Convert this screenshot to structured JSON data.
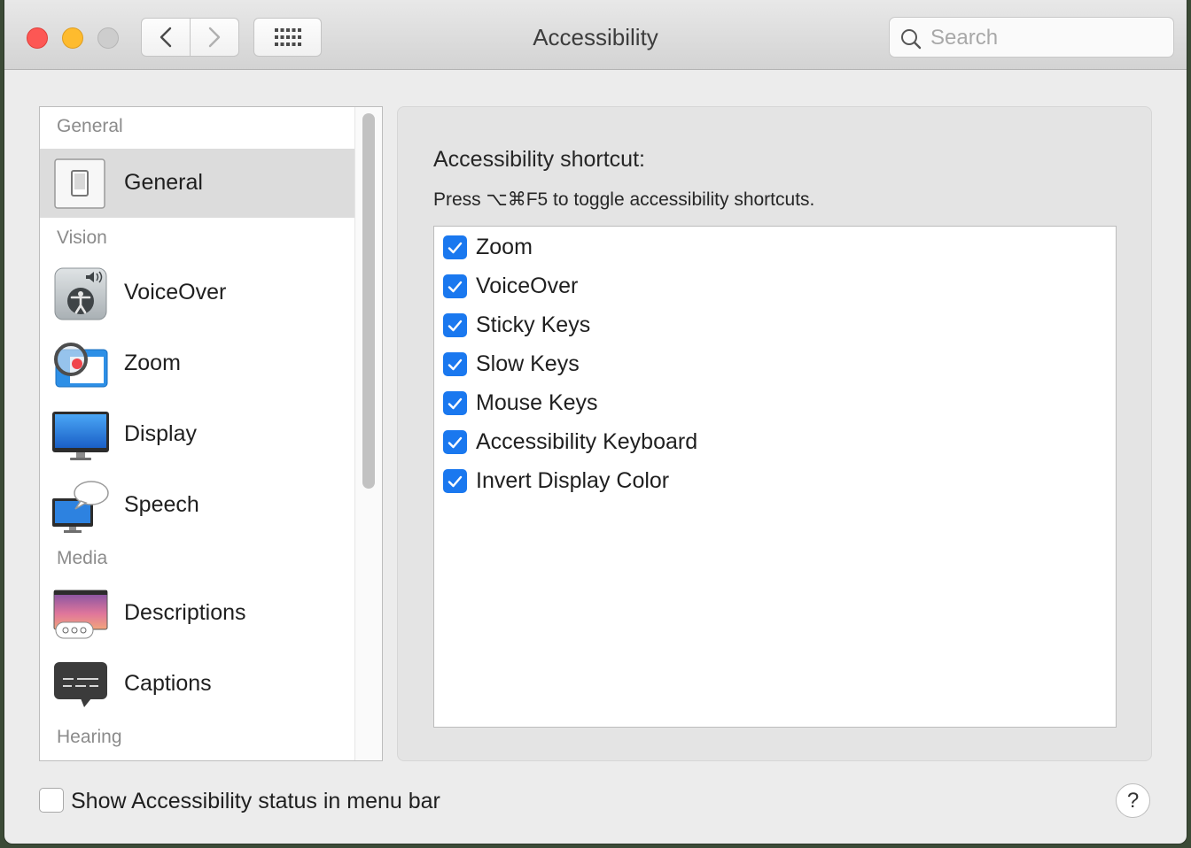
{
  "window": {
    "title": "Accessibility",
    "search_placeholder": "Search"
  },
  "sidebar": {
    "sections": [
      "General",
      "Vision",
      "Media",
      "Hearing"
    ],
    "items": [
      {
        "label": "General",
        "icon": "general-switch-icon",
        "selected": true
      },
      {
        "label": "VoiceOver",
        "icon": "voiceover-icon"
      },
      {
        "label": "Zoom",
        "icon": "zoom-magnifier-icon"
      },
      {
        "label": "Display",
        "icon": "display-monitor-icon"
      },
      {
        "label": "Speech",
        "icon": "speech-bubble-icon"
      },
      {
        "label": "Descriptions",
        "icon": "descriptions-icon"
      },
      {
        "label": "Captions",
        "icon": "captions-icon"
      }
    ]
  },
  "shortcut": {
    "title": "Accessibility shortcut:",
    "description": "Press ⌥⌘F5 to toggle accessibility shortcuts.",
    "options": [
      {
        "label": "Zoom",
        "checked": true
      },
      {
        "label": "VoiceOver",
        "checked": true
      },
      {
        "label": "Sticky Keys",
        "checked": true
      },
      {
        "label": "Slow Keys",
        "checked": true
      },
      {
        "label": "Mouse Keys",
        "checked": true
      },
      {
        "label": "Accessibility Keyboard",
        "checked": true
      },
      {
        "label": "Invert Display Color",
        "checked": true
      }
    ]
  },
  "footer": {
    "status_label": "Show Accessibility status in menu bar",
    "status_checked": false,
    "help_label": "?"
  },
  "colors": {
    "accent": "#1a78ef",
    "close": "#fd5754",
    "minimize": "#febb2e"
  }
}
